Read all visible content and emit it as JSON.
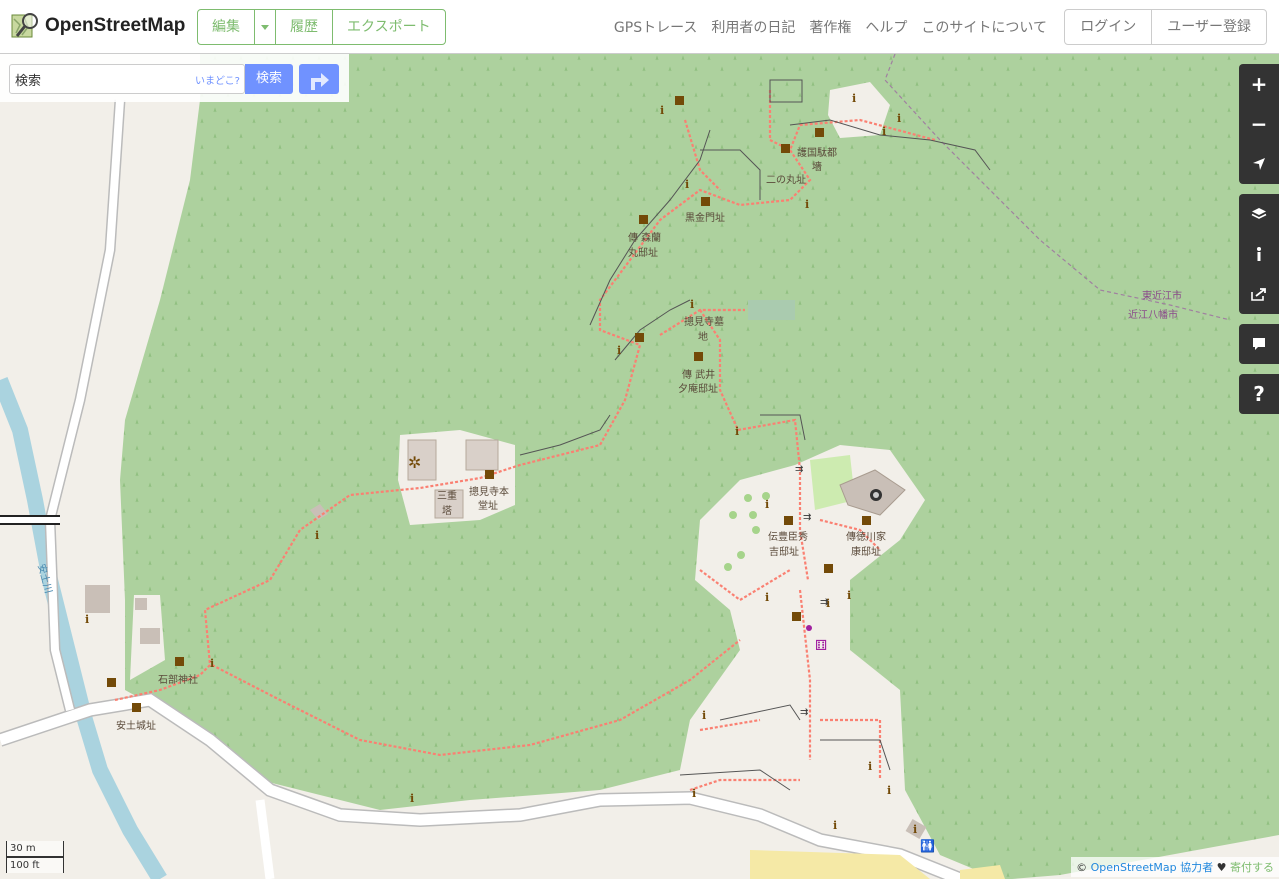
{
  "header": {
    "logo_text": "OpenStreetMap",
    "edit_label": "編集",
    "history_label": "履歴",
    "export_label": "エクスポート",
    "nav": [
      "GPSトレース",
      "利用者の日記",
      "著作権",
      "ヘルプ",
      "このサイトについて"
    ],
    "login_label": "ログイン",
    "signup_label": "ユーザー登録"
  },
  "search": {
    "value": "検索",
    "where_label": "いまどこ?",
    "button_label": "検索"
  },
  "map": {
    "labels": {
      "gokokusha": "護国駄都",
      "gokokusha2": "墻",
      "ninomaru": "二の丸址",
      "kuroganemon": "黒金門址",
      "morimaru": "傳 森蘭",
      "morimaru2": "丸邸址",
      "sokenji_grave": "摠見寺墓",
      "sokenji_grave2": "地",
      "takei": "傳 武井",
      "takei2": "夕庵邸址",
      "sanju": "三重",
      "sanju2": "塔",
      "sokenji_hondo": "摠見寺本",
      "sokenji_hondo2": "堂址",
      "hideyoshi": "伝豊臣秀",
      "hideyoshi2": "吉邸址",
      "ieyasu": "傳徳川家",
      "ieyasu2": "康邸址",
      "ishibe": "石部神社",
      "azuchi": "安土城址",
      "river": "安土川",
      "city1": "東近江市",
      "city2": "近江八幡市"
    }
  },
  "scale": {
    "metric": "30 m",
    "imperial": "100 ft"
  },
  "attribution": {
    "copy": "©",
    "osm": "OpenStreetMap",
    "contrib": "協力者",
    "heart": "♥",
    "donate": "寄付する"
  },
  "colors": {
    "osm_green": "#7ebc6f",
    "search_blue": "#7092ff",
    "forest": "#add19e",
    "path_red": "#fa8072"
  }
}
